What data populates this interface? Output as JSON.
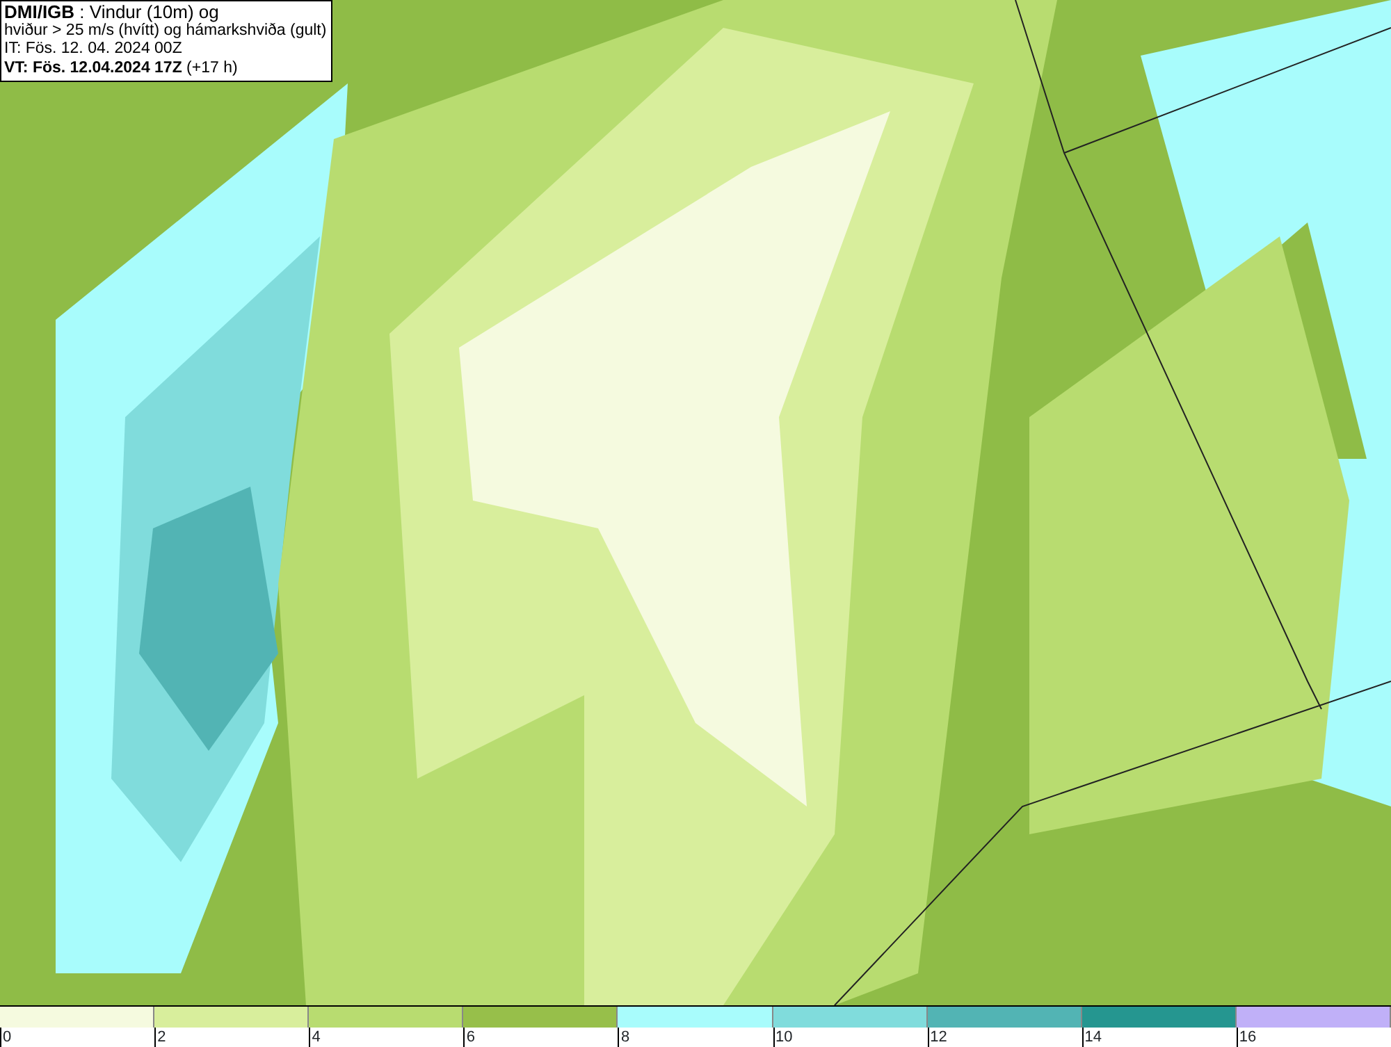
{
  "info_box": {
    "lines": [
      "**DMI/IGB** : Vindur (10m) og",
      "hviður > 25 m/s (hvítt) og hámarkshviða (gult)",
      "IT: Fös. 12. 04. 2024 00Z",
      "**VT: Fös. 12.04.2024 17Z** (+17 h)"
    ]
  },
  "legend": [
    {
      "label": "0",
      "color": "#f5fadf"
    },
    {
      "label": "2",
      "color": "#d8ee9c"
    },
    {
      "label": "4",
      "color": "#b8dc70"
    },
    {
      "label": "6",
      "color": "#97bf4a"
    },
    {
      "label": "8",
      "color": "#a8fcfc"
    },
    {
      "label": "10",
      "color": "#80dcdc"
    },
    {
      "label": "12",
      "color": "#52b4b4"
    },
    {
      "label": "14",
      "color": "#259690"
    },
    {
      "label": "16",
      "color": "#c0b0f8"
    }
  ]
}
